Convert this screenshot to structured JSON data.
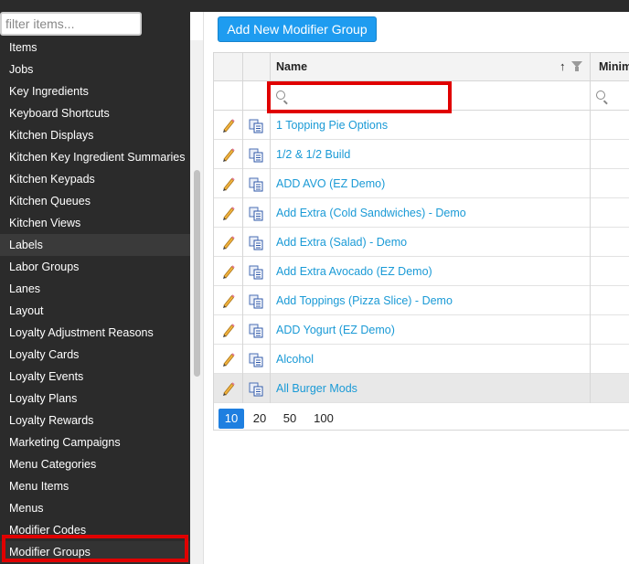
{
  "sidebar": {
    "filter_placeholder": "filter items...",
    "items": [
      "Items",
      "Jobs",
      "Key Ingredients",
      "Keyboard Shortcuts",
      "Kitchen Displays",
      "Kitchen Key Ingredient Summaries",
      "Kitchen Keypads",
      "Kitchen Queues",
      "Kitchen Views",
      "Labels",
      "Labor Groups",
      "Lanes",
      "Layout",
      "Loyalty Adjustment Reasons",
      "Loyalty Cards",
      "Loyalty Events",
      "Loyalty Plans",
      "Loyalty Rewards",
      "Marketing Campaigns",
      "Menu Categories",
      "Menu Items",
      "Menus",
      "Modifier Codes",
      "Modifier Groups"
    ],
    "hovered_item": "Labels",
    "active_item": "Modifier Groups"
  },
  "toolbar": {
    "add_label": "Add New Modifier Group"
  },
  "grid": {
    "columns": {
      "name": "Name",
      "minimum": "Minim"
    },
    "name_filter_value": "",
    "rows": [
      "1 Topping Pie Options",
      "1/2 & 1/2 Build",
      "ADD AVO (EZ Demo)",
      "Add Extra (Cold Sandwiches) - Demo",
      "Add Extra (Salad) - Demo",
      "Add Extra Avocado (EZ Demo)",
      "Add Toppings (Pizza Slice) - Demo",
      "ADD Yogurt (EZ Demo)",
      "Alcohol",
      "All Burger Mods"
    ],
    "selected_row": "All Burger Mods",
    "page_sizes": [
      "10",
      "20",
      "50",
      "100"
    ],
    "active_page_size": "10"
  },
  "colors": {
    "sidebar_bg": "#2b2b2b",
    "accent_button": "#1e9cf0",
    "link": "#1a9ad6",
    "highlight": "#e00000",
    "pager_active": "#1e7fe0"
  }
}
